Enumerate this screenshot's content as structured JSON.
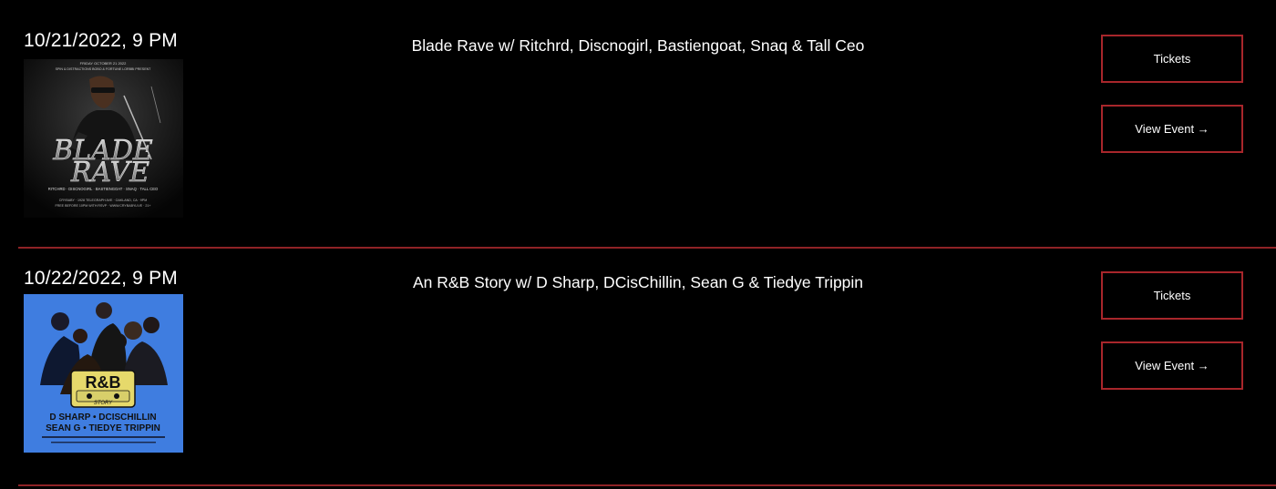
{
  "events": [
    {
      "date": "10/21/2022, 9 PM",
      "title": "Blade Rave w/ Ritchrd, Discnogirl, Bastiengoat, Snaq & Tall Ceo",
      "tickets_label": "Tickets",
      "view_label": "View Event →",
      "poster": {
        "header_lines": [
          "FRIDAY OCTOBER 21 2022",
          "SPIN & DISTRACTIONS BOBO & FORTUNE LORBBI PRESENT"
        ],
        "title_top": "BLADE",
        "title_bottom": "RAVE",
        "lineup": "RITCHRD · DISCNOGIRL · BASTIENGOAT · SNAQ · TALL CEO",
        "footer_lines": [
          "CRYBABY · 1928 TELEGRAPH AVE · OAKLAND, CA · 9PM",
          "FREE BEFORE 10PM WITH RSVP · WWW.CRYBABYLIVE · 21+"
        ]
      }
    },
    {
      "date": "10/22/2022, 9 PM",
      "title": "An R&B Story w/ D Sharp, DCisChillin, Sean G & Tiedye Trippin",
      "tickets_label": "Tickets",
      "view_label": "View Event →",
      "poster": {
        "logo_top": "R&B",
        "logo_bottom": "STORY",
        "lineup_1": "D SHARP • DCISCHILLIN",
        "lineup_2": "SEAN G • TIEDYE TRIPPIN"
      }
    }
  ],
  "colors": {
    "accent": "#a8262b",
    "background": "#000000",
    "poster2_bg": "#3f7de0"
  }
}
